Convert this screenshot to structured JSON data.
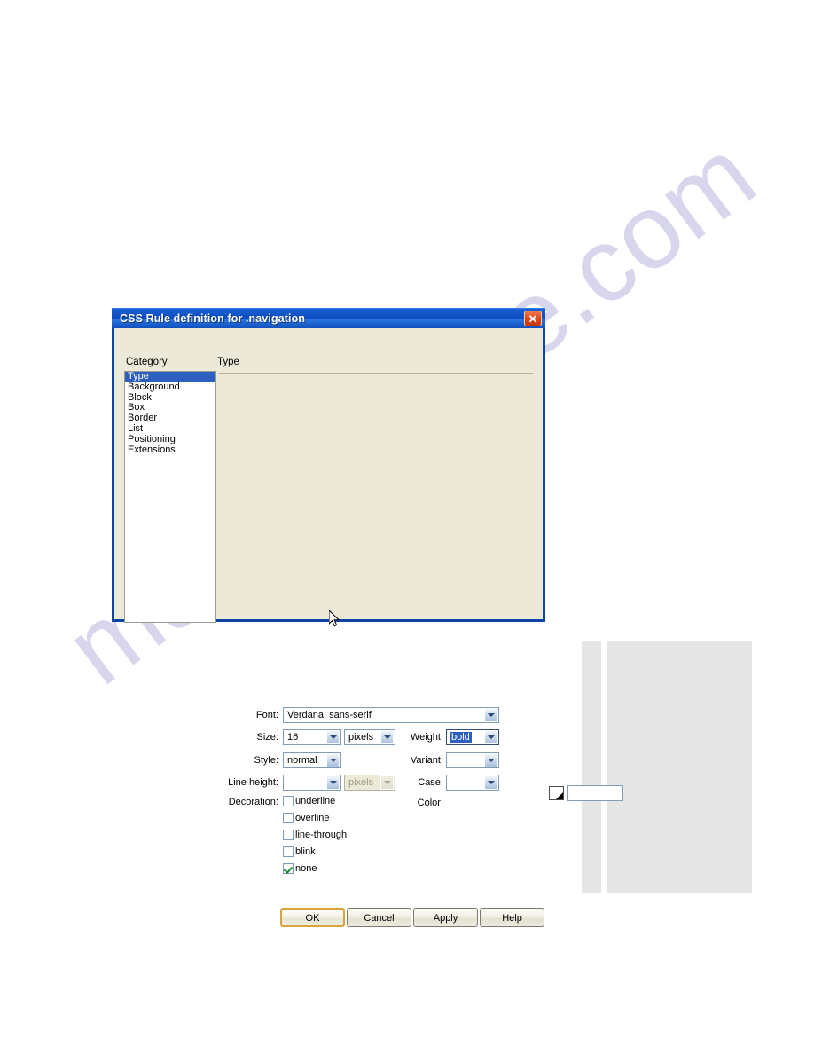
{
  "page": {
    "watermark_text": "manualshive.com",
    "watermark_color": "#b9b6e0",
    "background_color": "#ffffff"
  },
  "dialog": {
    "title": "CSS Rule definition for .navigation",
    "title_bar_color": "#0c4bc0",
    "body_color": "#ece9d8",
    "close_icon": "close-icon",
    "category": {
      "label": "Category",
      "items": [
        {
          "label": "Type",
          "selected": true
        },
        {
          "label": "Background",
          "selected": false
        },
        {
          "label": "Block",
          "selected": false
        },
        {
          "label": "Box",
          "selected": false
        },
        {
          "label": "Border",
          "selected": false
        },
        {
          "label": "List",
          "selected": false
        },
        {
          "label": "Positioning",
          "selected": false
        },
        {
          "label": "Extensions",
          "selected": false
        }
      ],
      "selection_color": "#2c5fbf"
    },
    "pane": {
      "title": "Type",
      "fields": {
        "font": {
          "label": "Font:",
          "value": "Verdana,  sans-serif",
          "placeholder": ""
        },
        "size": {
          "label": "Size:",
          "value": "16",
          "placeholder": ""
        },
        "size_units": {
          "label": "",
          "value": "pixels",
          "placeholder": ""
        },
        "weight": {
          "label": "Weight:",
          "value": "bold",
          "placeholder": "",
          "selected_text": true
        },
        "style": {
          "label": "Style:",
          "value": "normal",
          "placeholder": ""
        },
        "variant": {
          "label": "Variant:",
          "value": "",
          "placeholder": ""
        },
        "line_height": {
          "label": "Line height:",
          "value": "",
          "placeholder": ""
        },
        "line_height_units": {
          "label": "",
          "value": "pixels",
          "placeholder": "",
          "disabled": true
        },
        "case": {
          "label": "Case:",
          "value": "",
          "placeholder": ""
        },
        "color": {
          "label": "Color:",
          "value": "",
          "swatch": "#ffffff"
        }
      },
      "decoration": {
        "label": "Decoration:",
        "options": [
          {
            "label": "underline",
            "checked": false
          },
          {
            "label": "overline",
            "checked": false
          },
          {
            "label": "line-through",
            "checked": false
          },
          {
            "label": "blink",
            "checked": false
          },
          {
            "label": "none",
            "checked": true
          }
        ],
        "check_color": "#128a2e"
      }
    },
    "buttons": [
      {
        "label": "OK",
        "default": true
      },
      {
        "label": "Cancel",
        "default": false
      },
      {
        "label": "Apply",
        "default": false
      },
      {
        "label": "Help",
        "default": false
      }
    ],
    "default_button_border": "#d9a43c"
  },
  "decorative_panels": [
    {
      "name": "narrow-gray-bar",
      "color": "#e6e6e6"
    },
    {
      "name": "wide-gray-panel",
      "color": "#e6e6e6"
    }
  ]
}
